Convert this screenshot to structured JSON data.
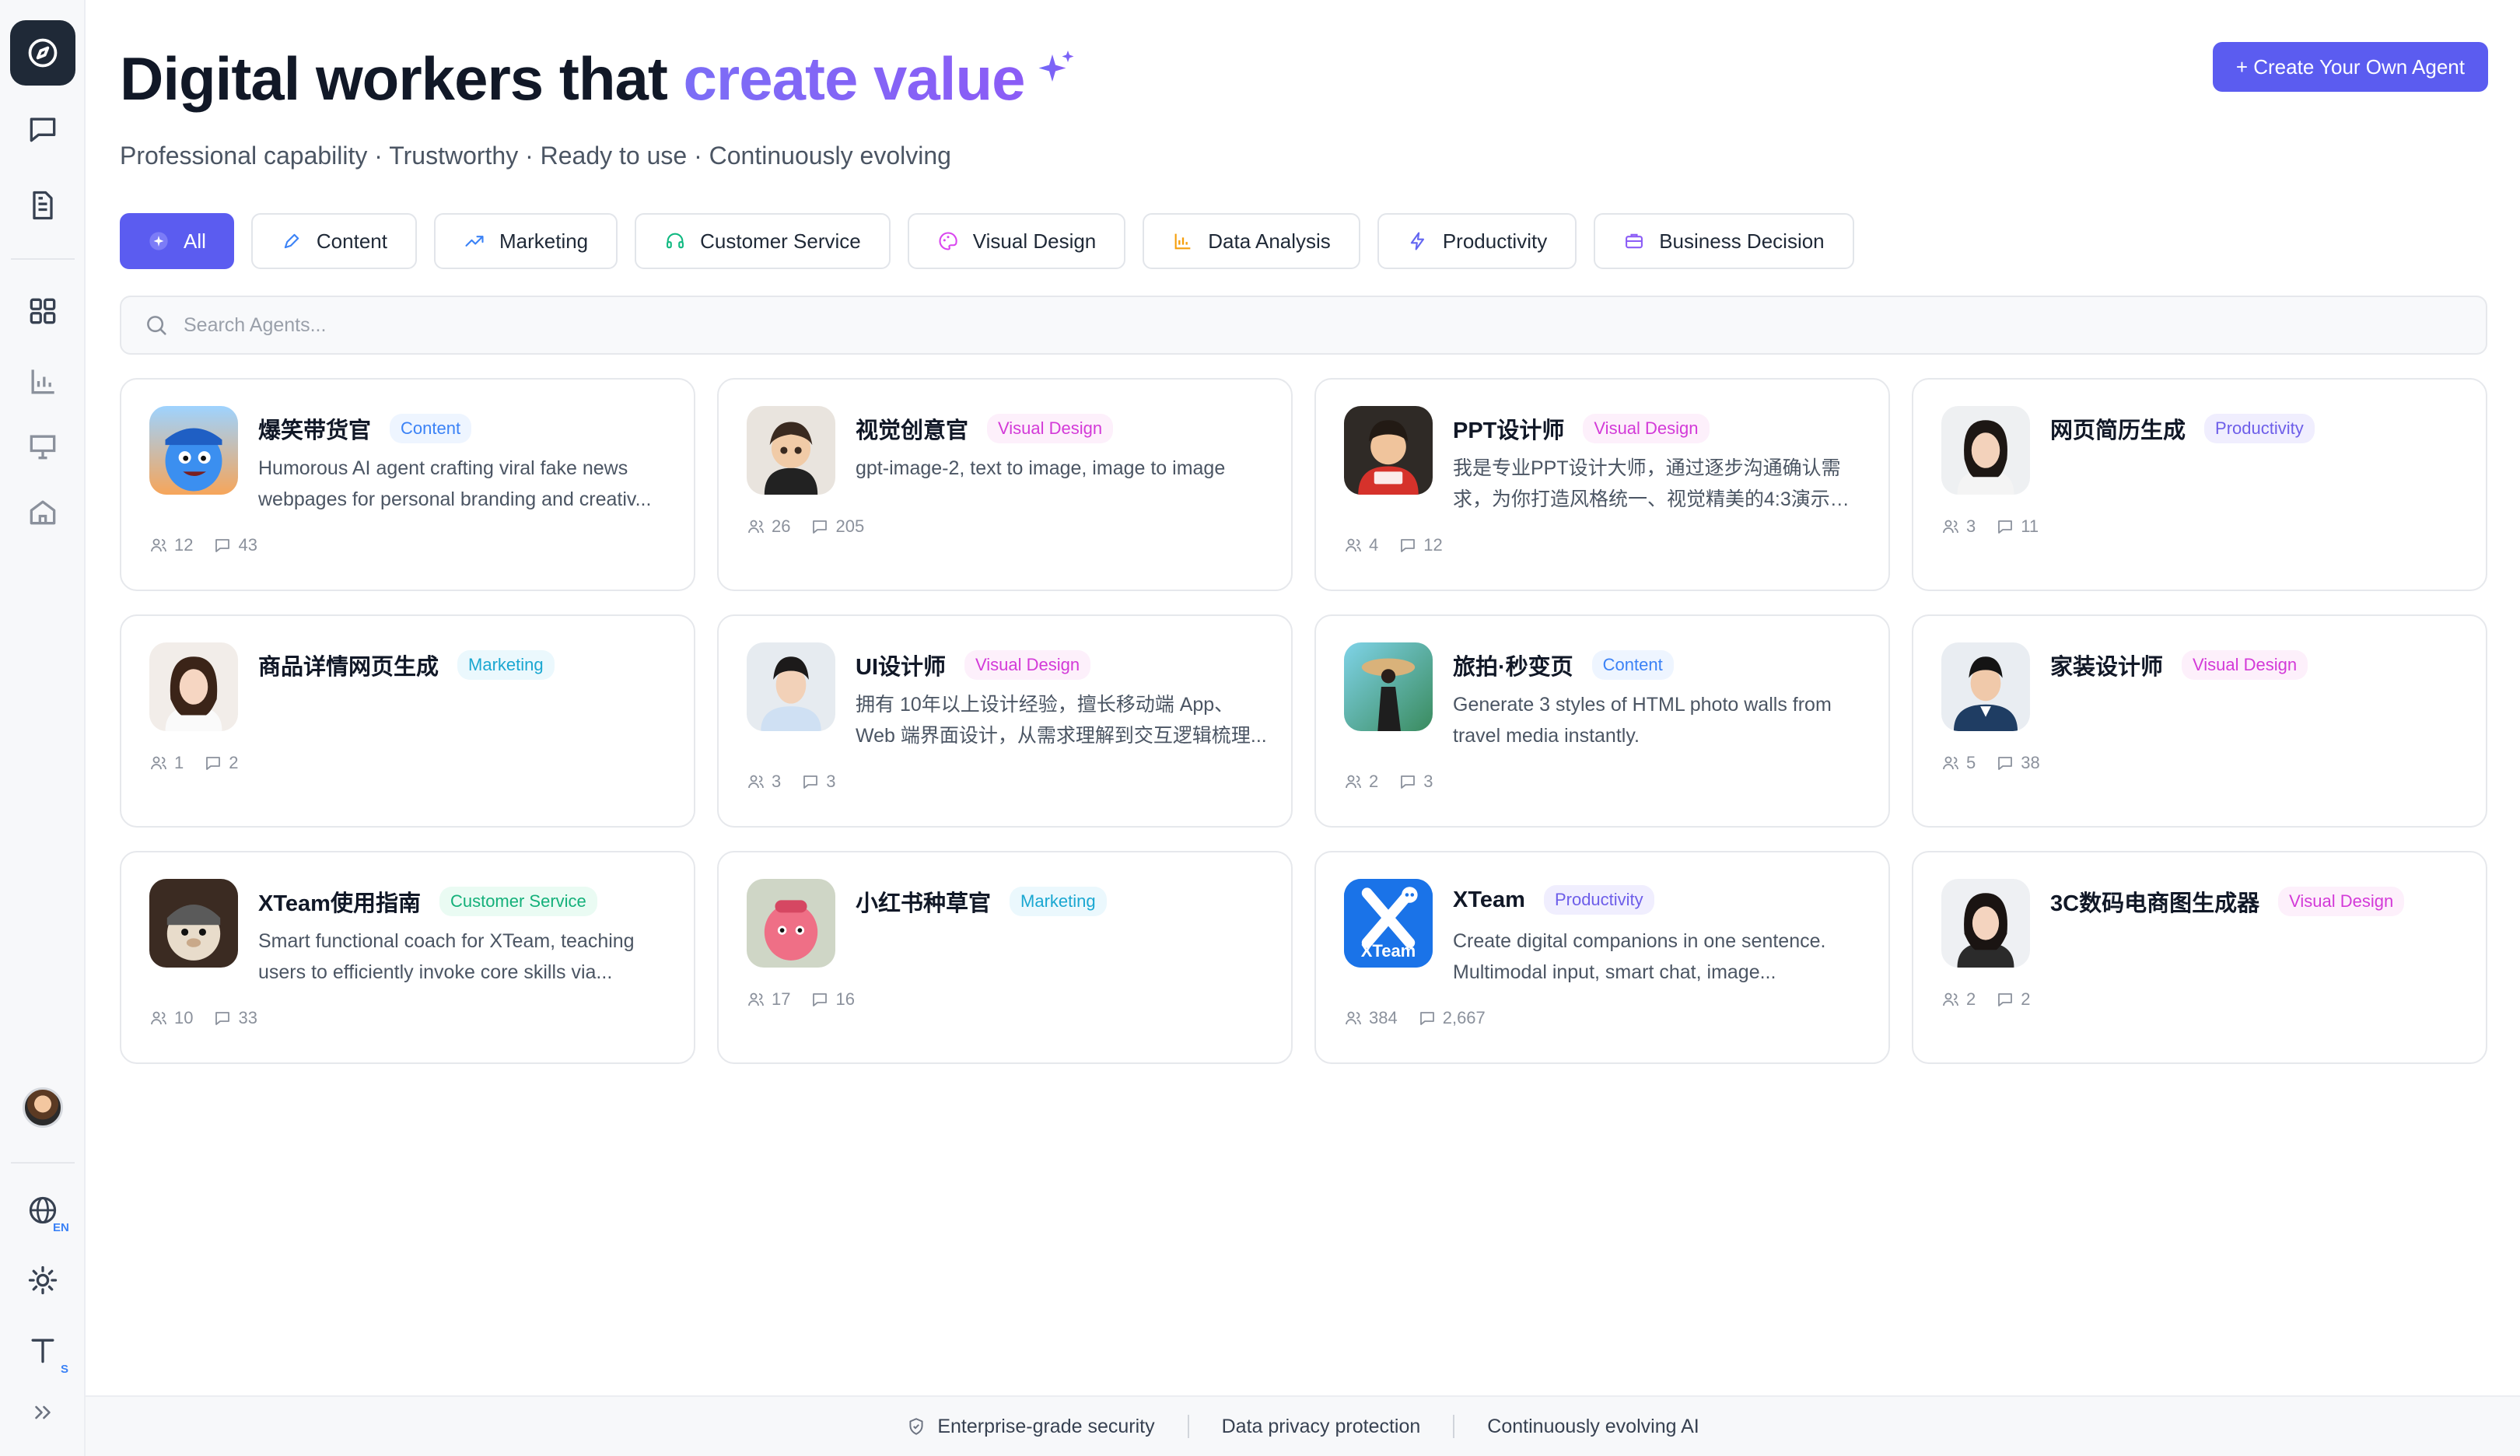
{
  "header": {
    "title_main": "Digital workers that ",
    "title_accent": "create value",
    "subtitle": "Professional capability · Trustworthy · Ready to use · Continuously evolving",
    "create_button": "+ Create Your Own Agent"
  },
  "sidebar": {
    "language_badge": "EN",
    "font_size_badge": "S",
    "icons": [
      "compass-icon",
      "chat-icon",
      "document-icon",
      "grid-icon",
      "chart-icon",
      "presentation-icon",
      "home-icon",
      "globe-icon",
      "sun-icon",
      "text-size-icon",
      "expand-icon"
    ]
  },
  "tabs": [
    {
      "label": "All",
      "icon": "sparkle-icon",
      "color": "#ffffff"
    },
    {
      "label": "Content",
      "icon": "pen-icon",
      "color": "#3b82f6"
    },
    {
      "label": "Marketing",
      "icon": "trend-icon",
      "color": "#3b82f6"
    },
    {
      "label": "Customer Service",
      "icon": "headset-icon",
      "color": "#10b981"
    },
    {
      "label": "Visual Design",
      "icon": "palette-icon",
      "color": "#d946ef"
    },
    {
      "label": "Data Analysis",
      "icon": "bar-chart-icon",
      "color": "#f59e0b"
    },
    {
      "label": "Productivity",
      "icon": "bolt-icon",
      "color": "#6366f1"
    },
    {
      "label": "Business Decision",
      "icon": "briefcase-icon",
      "color": "#8b5cf6"
    }
  ],
  "search": {
    "placeholder": "Search Agents..."
  },
  "agents": [
    {
      "name": "爆笑带货官",
      "category": "Content",
      "desc": "Humorous AI agent crafting viral fake news webpages for personal branding and creativ...",
      "users": "12",
      "chats": "43"
    },
    {
      "name": "视觉创意官",
      "category": "Visual Design",
      "desc": "gpt-image-2,   text to image, image to image",
      "users": "26",
      "chats": "205"
    },
    {
      "name": "PPT设计师",
      "category": "Visual Design",
      "desc": "我是专业PPT设计大师，通过逐步沟通确认需求，为你打造风格统一、视觉精美的4:3演示文...",
      "users": "4",
      "chats": "12"
    },
    {
      "name": "网页简历生成",
      "category": "Productivity",
      "desc": "",
      "users": "3",
      "chats": "11"
    },
    {
      "name": "商品详情网页生成",
      "category": "Marketing",
      "desc": "",
      "users": "1",
      "chats": "2"
    },
    {
      "name": "UI设计师",
      "category": "Visual Design",
      "desc": "拥有 10年以上设计经验，擅长移动端 App、Web 端界面设计，从需求理解到交互逻辑梳理...",
      "users": "3",
      "chats": "3"
    },
    {
      "name": "旅拍·秒变页",
      "category": "Content",
      "desc": "Generate 3 styles of HTML photo walls from travel media instantly.",
      "users": "2",
      "chats": "3"
    },
    {
      "name": "家装设计师",
      "category": "Visual Design",
      "desc": "",
      "users": "5",
      "chats": "38"
    },
    {
      "name": "XTeam使用指南",
      "category": "Customer Service",
      "desc": "Smart functional coach for XTeam, teaching users to efficiently invoke core skills via...",
      "users": "10",
      "chats": "33"
    },
    {
      "name": "小红书种草官",
      "category": "Marketing",
      "desc": "",
      "users": "17",
      "chats": "16"
    },
    {
      "name": "XTeam",
      "category": "Productivity",
      "desc": "Create digital companions in one sentence. Multimodal input, smart chat, image...",
      "users": "384",
      "chats": "2,667"
    },
    {
      "name": "3C数码电商图生成器",
      "category": "Visual Design",
      "desc": "",
      "users": "2",
      "chats": "2"
    }
  ],
  "xteam_logo_text": "XTeam",
  "footer": {
    "security": "Enterprise-grade security",
    "privacy": "Data privacy protection",
    "evolving": "Continuously evolving AI"
  }
}
